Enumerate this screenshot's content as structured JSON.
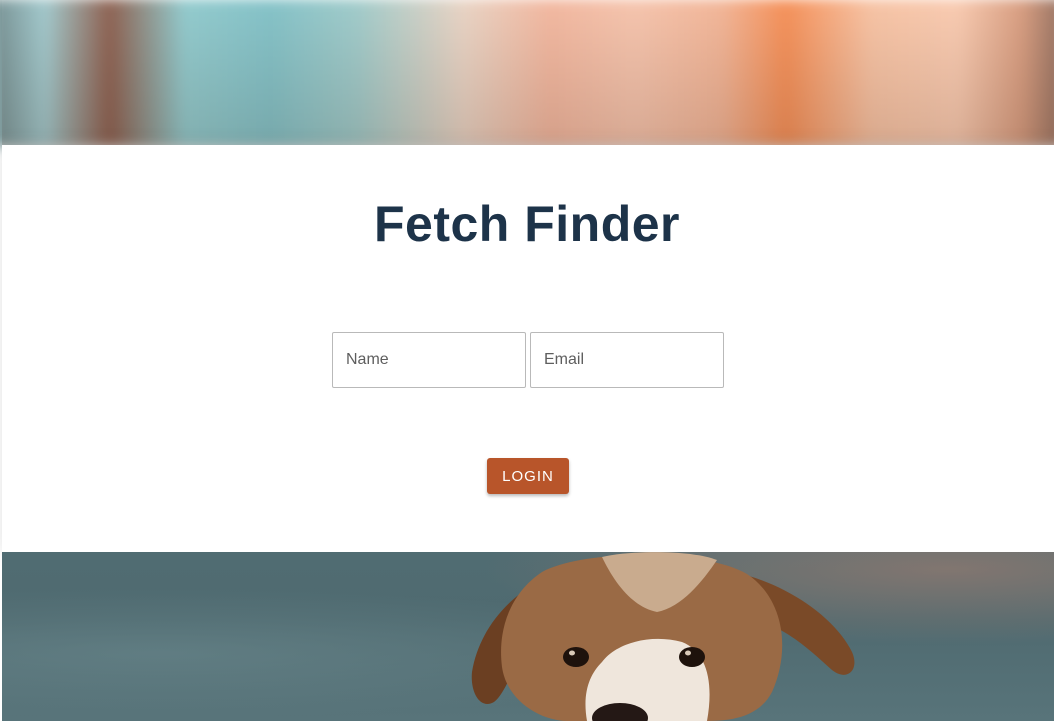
{
  "app": {
    "title": "Fetch Finder"
  },
  "login_form": {
    "name_placeholder": "Name",
    "email_placeholder": "Email",
    "name_value": "",
    "email_value": "",
    "login_label": "LOGIN"
  },
  "colors": {
    "title": "#1d3349",
    "login_button": "#b8552a",
    "card_background": "#ffffff"
  },
  "images": {
    "top_banner": "blurred-colorful-background-image",
    "bottom_banner": "dog-photo-image"
  }
}
